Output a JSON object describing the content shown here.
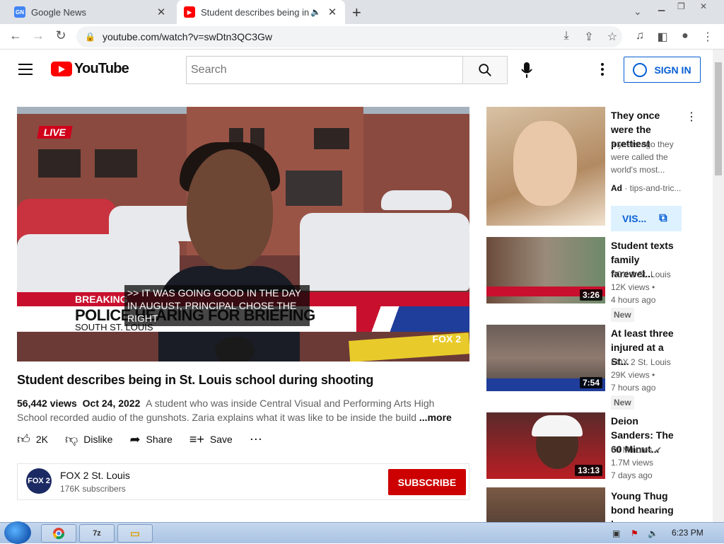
{
  "browser": {
    "tabs": [
      {
        "label": "Google News",
        "favicon": "google-news-icon"
      },
      {
        "label": "Student describes being in St.",
        "favicon": "youtube-icon"
      }
    ],
    "url": "youtube.com/watch?v=swDtn3QC3Gw"
  },
  "youtube": {
    "logo_text": "YouTube",
    "search_placeholder": "Search",
    "sign_in_label": "SIGN IN"
  },
  "video": {
    "overlay_live": "LIVE",
    "lower_third_red": "BREAKING",
    "lower_third_headline": "POLICE HEARING FOR BRIEFING",
    "lower_third_sub": "SOUTH ST. LOUIS",
    "caption": ">> IT WAS GOING GOOD IN THE DAY IN AUGUST, PRINCIPAL CHOSE THE RIGHT",
    "watermark": "FOX 2",
    "title": "Student describes being in St. Louis school during shooting",
    "views": "56,442 views",
    "date": "Oct 24, 2022",
    "description": "A student who was inside Central Visual and Performing Arts High School recorded audio of the gunshots. Zaria explains what it was like to be inside the build",
    "more_label": "...more",
    "likes": "2K",
    "dislike_label": "Dislike",
    "share_label": "Share",
    "save_label": "Save"
  },
  "channel": {
    "avatar_text": "FOX 2",
    "name": "FOX 2 St. Louis",
    "subscribers": "176K subscribers",
    "subscribe_label": "SUBSCRIBE"
  },
  "sidebar": {
    "ad": {
      "title": "They once were the prettiest",
      "desc": "9 years ago they were called the world's most...",
      "ad_label": "Ad",
      "domain": "tips-and-tric...",
      "visit_label": "VIS..."
    },
    "items": [
      {
        "title": "Student texts family farewel...",
        "channel": "FOX 2 St. Louis",
        "views": "12K views",
        "age": "4 hours ago",
        "badge": "New",
        "duration": "3:26"
      },
      {
        "title": "At least three injured at a St...",
        "channel": "FOX 2 St. Louis",
        "views": "29K views",
        "age": "7 hours ago",
        "badge": "New",
        "duration": "7:54"
      },
      {
        "title": "Deion Sanders: The 60 Minut...",
        "channel": "60 Minutes",
        "views": "1.7M views",
        "age": "7 days ago",
        "badge": "",
        "duration": "13:13"
      },
      {
        "title": "Young Thug bond hearing |...",
        "channel": "",
        "views": "",
        "age": "",
        "badge": "",
        "duration": ""
      }
    ]
  },
  "taskbar": {
    "clock": "6:23 PM",
    "app_7z": "7z"
  },
  "colors": {
    "youtube_red": "#ff0000",
    "subscribe_red": "#cc0000",
    "link_blue": "#065fd4"
  }
}
